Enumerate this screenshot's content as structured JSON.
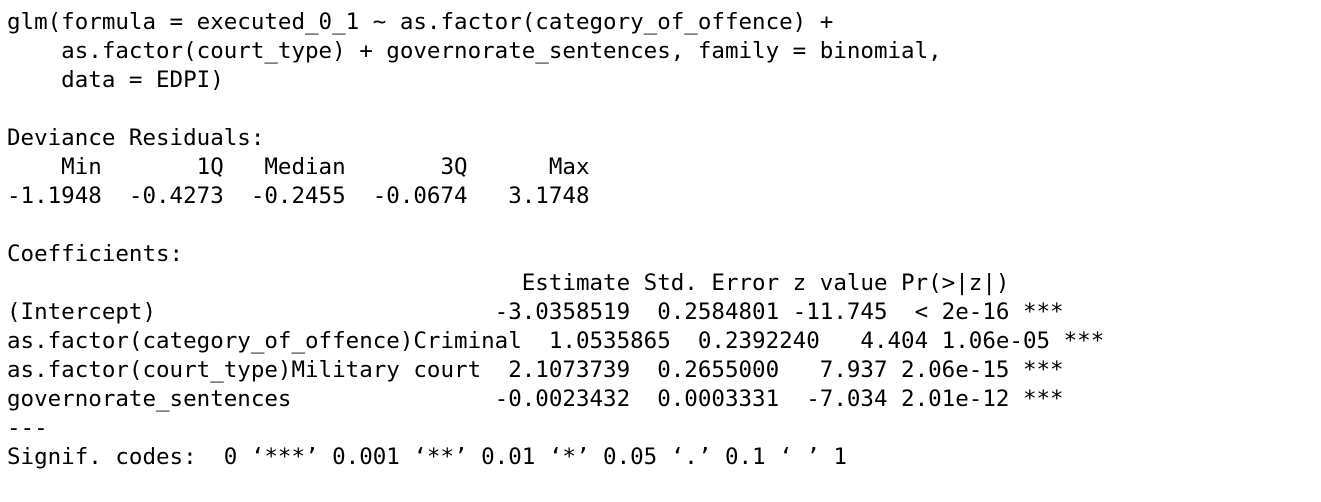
{
  "console": {
    "call": {
      "line1": "glm(formula = executed_0_1 ~ as.factor(category_of_offence) +",
      "line2": "    as.factor(court_type) + governorate_sentences, family = binomial,",
      "line3": "    data = EDPI)"
    },
    "deviance_residuals": {
      "heading": "Deviance Residuals:",
      "header_row": "    Min       1Q   Median       3Q      Max  ",
      "value_row": "-1.1948  -0.4273  -0.2455  -0.0674   3.1748  ",
      "columns": [
        "Min",
        "1Q",
        "Median",
        "3Q",
        "Max"
      ],
      "values": [
        "-1.1948",
        "-0.4273",
        "-0.2455",
        "-0.0674",
        "3.1748"
      ]
    },
    "coefficients": {
      "heading": "Coefficients:",
      "header_row": "                                      Estimate Std. Error z value Pr(>|z|)    ",
      "rows": [
        {
          "text": "(Intercept)                         -3.0358519  0.2584801 -11.745  < 2e-16 ***",
          "term": "(Intercept)",
          "estimate": "-3.0358519",
          "std_error": "0.2584801",
          "z_value": "-11.745",
          "p_value": "< 2e-16",
          "signif": "***"
        },
        {
          "text": "as.factor(category_of_offence)Criminal  1.0535865  0.2392240   4.404 1.06e-05 ***",
          "term": "as.factor(category_of_offence)Criminal",
          "estimate": "1.0535865",
          "std_error": "0.2392240",
          "z_value": "4.404",
          "p_value": "1.06e-05",
          "signif": "***"
        },
        {
          "text": "as.factor(court_type)Military court  2.1073739  0.2655000   7.937 2.06e-15 ***",
          "term": "as.factor(court_type)Military court",
          "estimate": "2.1073739",
          "std_error": "0.2655000",
          "z_value": "7.937",
          "p_value": "2.06e-15",
          "signif": "***"
        },
        {
          "text": "governorate_sentences               -0.0023432  0.0003331  -7.034 2.01e-12 ***",
          "term": "governorate_sentences",
          "estimate": "-0.0023432",
          "std_error": "0.0003331",
          "z_value": "-7.034",
          "p_value": "2.01e-12",
          "signif": "***"
        }
      ],
      "separator": "---",
      "signif_codes": "Signif. codes:  0 ‘***’ 0.001 ‘**’ 0.01 ‘*’ 0.05 ‘.’ 0.1 ‘ ’ 1"
    }
  }
}
